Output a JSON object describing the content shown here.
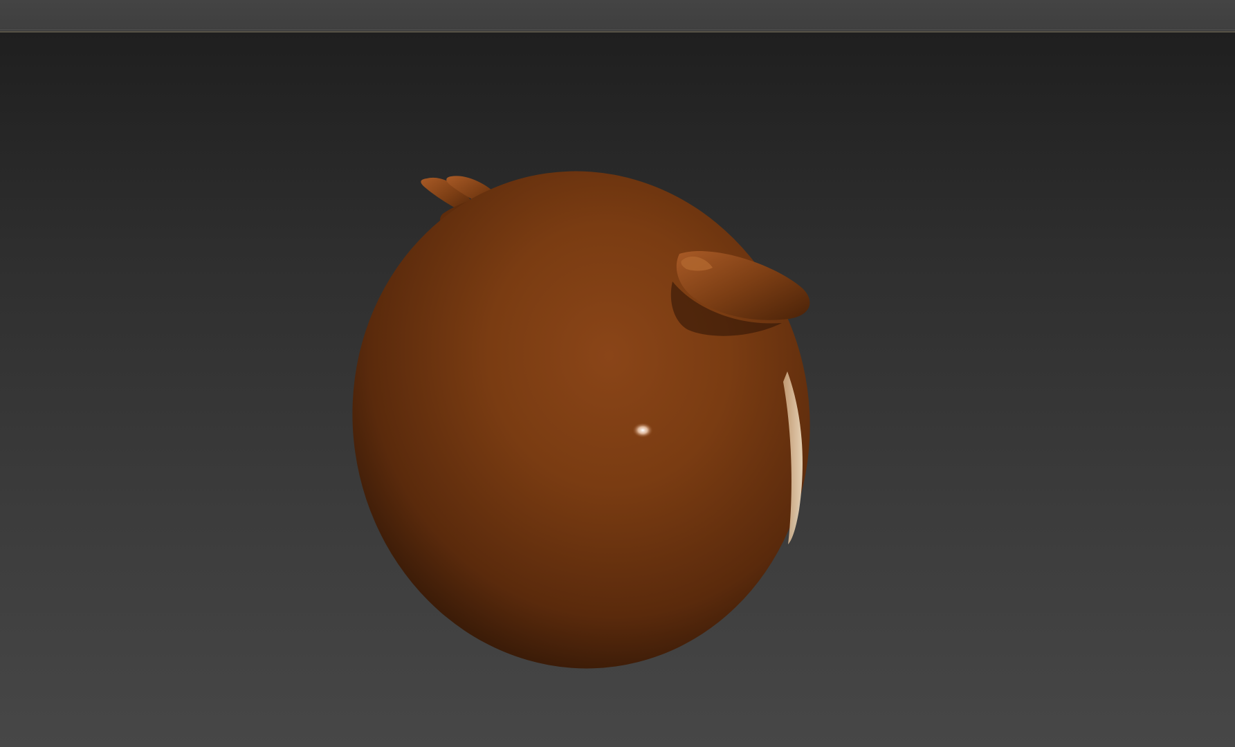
{
  "window": {
    "title": ""
  },
  "viewport": {
    "background_top": "#1f1f1f",
    "background_bottom": "#474747",
    "frame_line_color": "#6b6656"
  },
  "model": {
    "name": "brown-sphere-creature",
    "base_color": "#7a3a10",
    "highlight_color": "#ffffff",
    "rim_color": "#e8d2b0"
  },
  "toolbar": {
    "background": "#424242"
  }
}
